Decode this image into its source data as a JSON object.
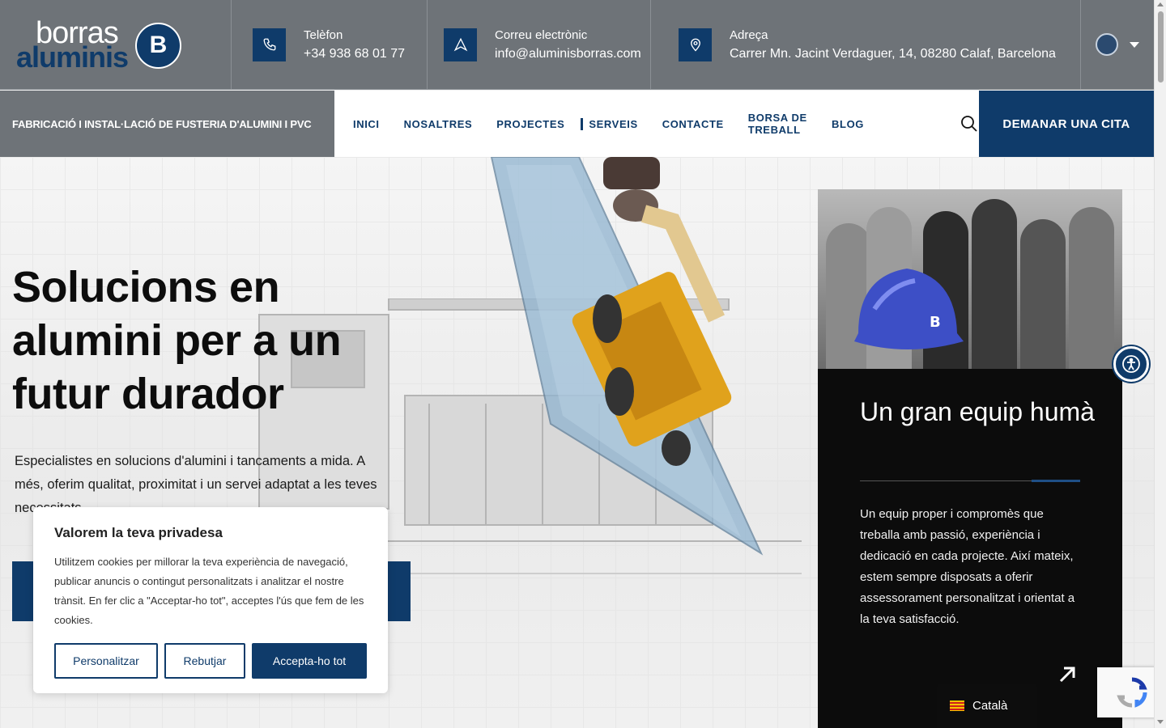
{
  "logo": {
    "word1": "borras",
    "word2": "aluminis",
    "mark": "B"
  },
  "contacts": {
    "phone": {
      "title": "Telèfon",
      "value": "+34 938 68 01 77",
      "icon": "phone-icon"
    },
    "email": {
      "title": "Correu electrònic",
      "value": "info@aluminisborras.com",
      "icon": "send-icon"
    },
    "address": {
      "title": "Adreça",
      "value": "Carrer Mn. Jacint Verdaguer, 14, 08280 Calaf, Barcelona",
      "icon": "map-pin-icon"
    }
  },
  "tagline": "FABRICACIÓ I INSTAL·LACIÓ DE FUSTERIA D'ALUMINI I PVC",
  "nav": {
    "items": [
      "INICI",
      "NOSALTRES",
      "PROJECTES",
      "SERVEIS",
      "CONTACTE",
      "BORSA DE TREBALL",
      "BLOG"
    ],
    "active_index": 3,
    "cta": "DEMANAR UNA CITA"
  },
  "hero": {
    "title": "Solucions en alumini per a un futur durador",
    "lead": "Especialistes en solucions d'alumini i tancaments a mida. A més, oferim qualitat, proximitat i un servei adaptat a les teves necessitats."
  },
  "card": {
    "title": "Un gran equip humà",
    "text": "Un equip proper i compromès que treballa amb passió, experiència i dedicació en cada projecte. Així mateix, estem sempre disposats a oferir assessorament personalitzat i orientat a la teva satisfacció."
  },
  "cookie": {
    "title": "Valorem la teva privadesa",
    "text": "Utilitzem cookies per millorar la teva experiència de navegació, publicar anuncis o contingut personalitzats i analitzar el nostre trànsit. En fer clic a \"Acceptar-ho tot\", acceptes l'ús que fem de les cookies.",
    "customize": "Personalitzar",
    "reject": "Rebutjar",
    "accept": "Accepta-ho tot"
  },
  "language": {
    "current": "Català"
  },
  "colors": {
    "brand": "#0f3b6a",
    "topbar": "#6e7378",
    "card": "#0c0c0c"
  }
}
